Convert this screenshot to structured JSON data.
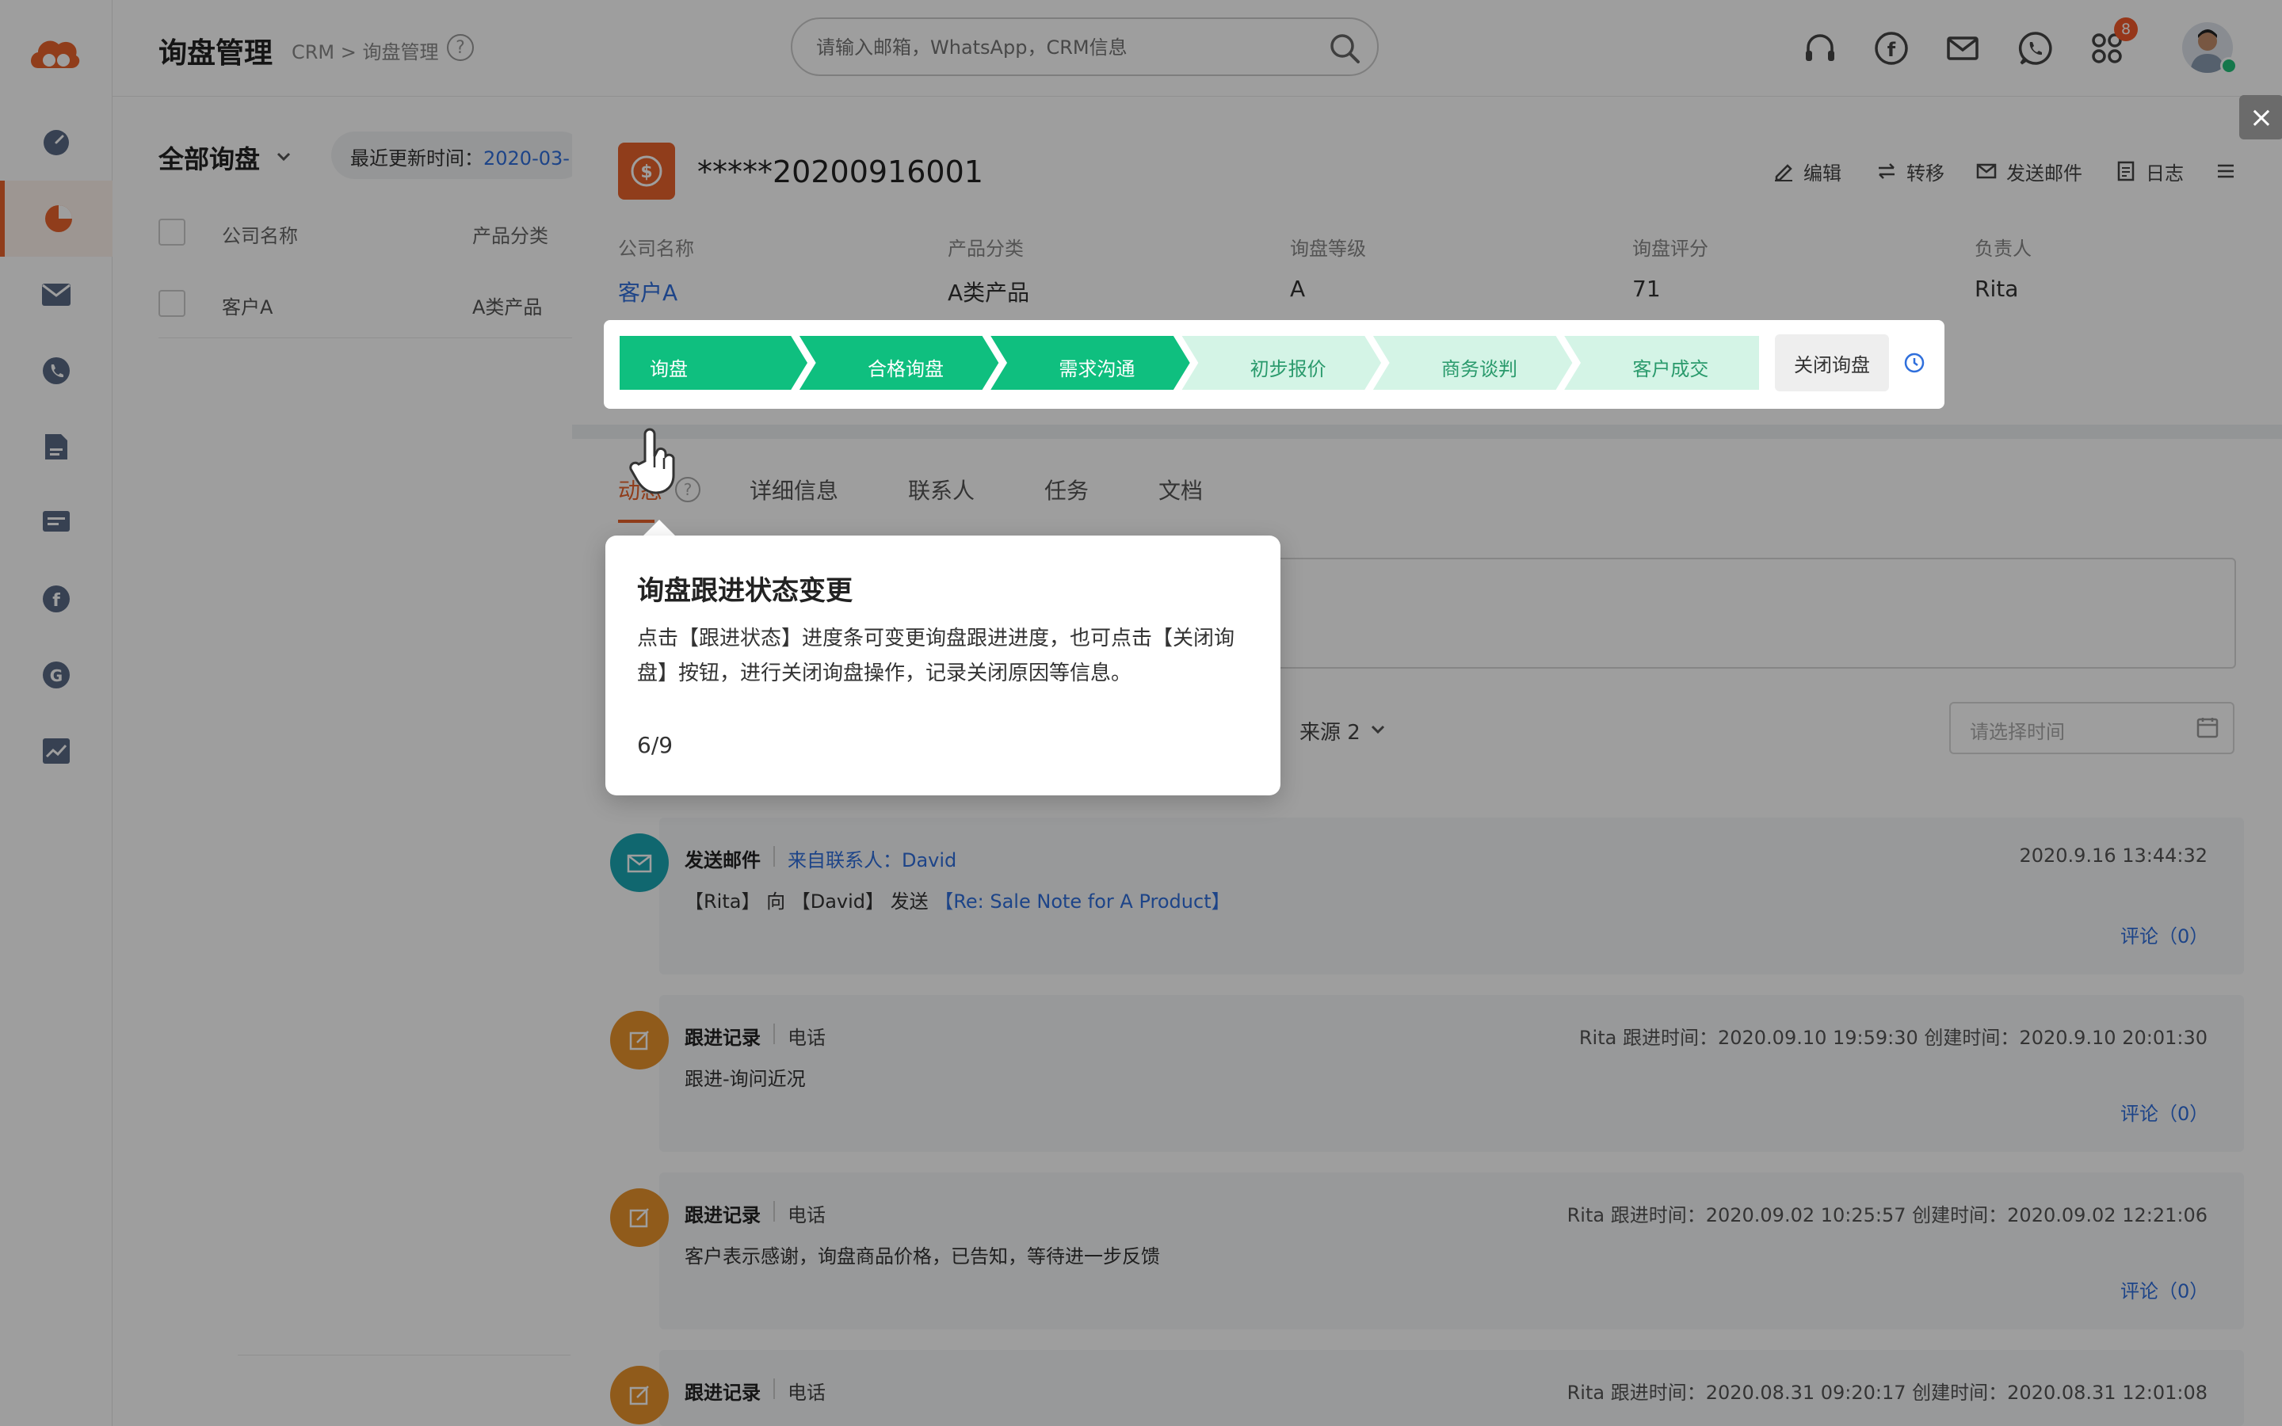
{
  "header": {
    "title": "询盘管理",
    "breadcrumb": "CRM > 询盘管理",
    "help": "?",
    "search_placeholder": "请输入邮箱，WhatsApp，CRM信息",
    "notification_count": "8",
    "icons": [
      "headset-icon",
      "facebook-icon",
      "mail-icon",
      "whatsapp-icon",
      "apps-icon"
    ]
  },
  "sidebar": {
    "items": [
      "dashboard-icon",
      "pie-chart-icon",
      "mail-icon",
      "phone-icon",
      "document-icon",
      "message-icon",
      "facebook-icon",
      "google-icon",
      "trend-chart-icon"
    ],
    "active_index": 1,
    "accent_color": "#e8632d"
  },
  "list": {
    "title": "全部询盘",
    "filter_label": "最近更新时间：",
    "filter_value": "2020-03-",
    "columns": [
      "公司名称",
      "产品分类"
    ],
    "rows": [
      {
        "company": "客户A",
        "category": "A类产品"
      }
    ]
  },
  "detail": {
    "deal_id": "*****20200916001",
    "actions": {
      "edit": "编辑",
      "transfer": "转移",
      "send_email": "发送邮件",
      "log": "日志"
    },
    "fields": [
      {
        "label": "公司名称",
        "value": "客户A"
      },
      {
        "label": "产品分类",
        "value": "A类产品"
      },
      {
        "label": "询盘等级",
        "value": "A"
      },
      {
        "label": "询盘评分",
        "value": "71"
      },
      {
        "label": "负责人",
        "value": "Rita"
      }
    ],
    "stages": [
      {
        "label": "询盘",
        "done": true
      },
      {
        "label": "合格询盘",
        "done": true
      },
      {
        "label": "需求沟通",
        "done": true
      },
      {
        "label": "初步报价",
        "done": false
      },
      {
        "label": "商务谈判",
        "done": false
      },
      {
        "label": "客户成交",
        "done": false
      }
    ],
    "stage_done_color": "#0fbf7f",
    "stage_todo_color": "#d4f4e6",
    "close_deal": "关闭询盘",
    "tabs": [
      "动态",
      "详细信息",
      "联系人",
      "任务",
      "文档"
    ],
    "tab_help": "?",
    "source_filter": "来源 2",
    "date_placeholder": "请选择时间"
  },
  "timeline": [
    {
      "type": "发送邮件",
      "sub": "来自联系人：David",
      "meta": "2020.9.16 13:44:32",
      "body_prefix": "【Rita】 向 【David】 发送 ",
      "body_link": "【Re: Sale Note for A Product】",
      "comment": "评论（0）"
    },
    {
      "type": "跟进记录",
      "sub": "电话",
      "meta": "Rita   跟进时间：2020.09.10 19:59:30 创建时间：2020.9.10 20:01:30",
      "body": "跟进-询问近况",
      "comment": "评论（0）"
    },
    {
      "type": "跟进记录",
      "sub": "电话",
      "meta": "Rita   跟进时间：2020.09.02 10:25:57 创建时间：2020.09.02 12:21:06",
      "body": "客户表示感谢，询盘商品价格，已告知，等待进一步反馈",
      "comment": "评论（0）"
    },
    {
      "type": "跟进记录",
      "sub": "电话",
      "meta": "Rita   跟进时间：2020.08.31 09:20:17 创建时间：2020.08.31 12:01:08"
    }
  ],
  "tooltip": {
    "title": "询盘跟进状态变更",
    "body": "点击【跟进状态】进度条可变更询盘跟进进度，也可点击【关闭询盘】按钮，进行关闭询盘操作，记录关闭原因等信息。",
    "step": "6/9"
  }
}
